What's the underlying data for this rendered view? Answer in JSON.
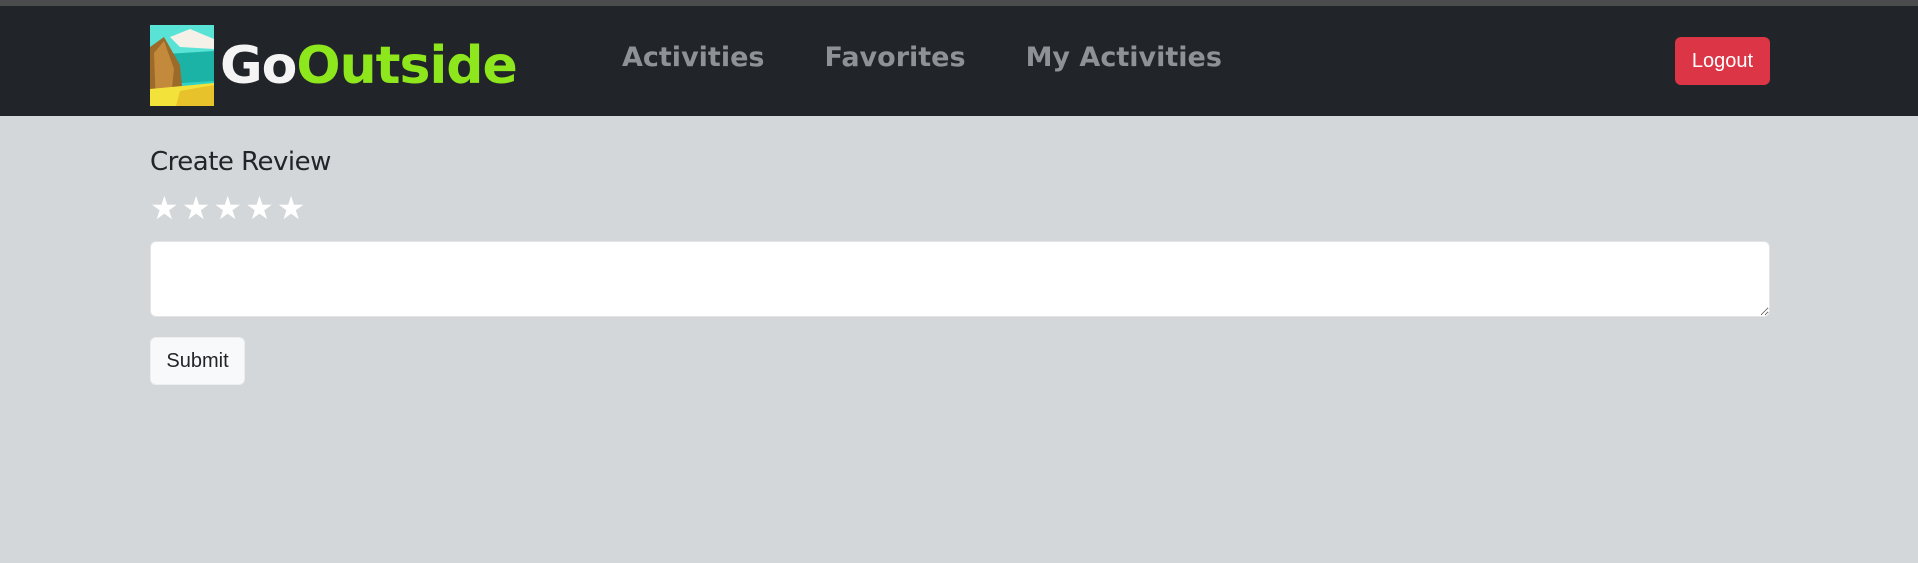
{
  "header": {
    "logo": {
      "text_go": "Go",
      "text_outside": "Outside",
      "icon": "mountain-landscape-icon"
    },
    "nav": [
      {
        "label": "Activities"
      },
      {
        "label": "Favorites"
      },
      {
        "label": "My Activities"
      }
    ],
    "logout_label": "Logout"
  },
  "review": {
    "title": "Create Review",
    "rating": {
      "max": 5,
      "value": 0,
      "icon": "star-icon"
    },
    "textarea_value": "",
    "submit_label": "Submit"
  },
  "colors": {
    "navbar_bg": "#212529",
    "page_bg": "#d3d7d9",
    "brand_green": "#8ee61d",
    "logout_red": "#dc3545"
  }
}
